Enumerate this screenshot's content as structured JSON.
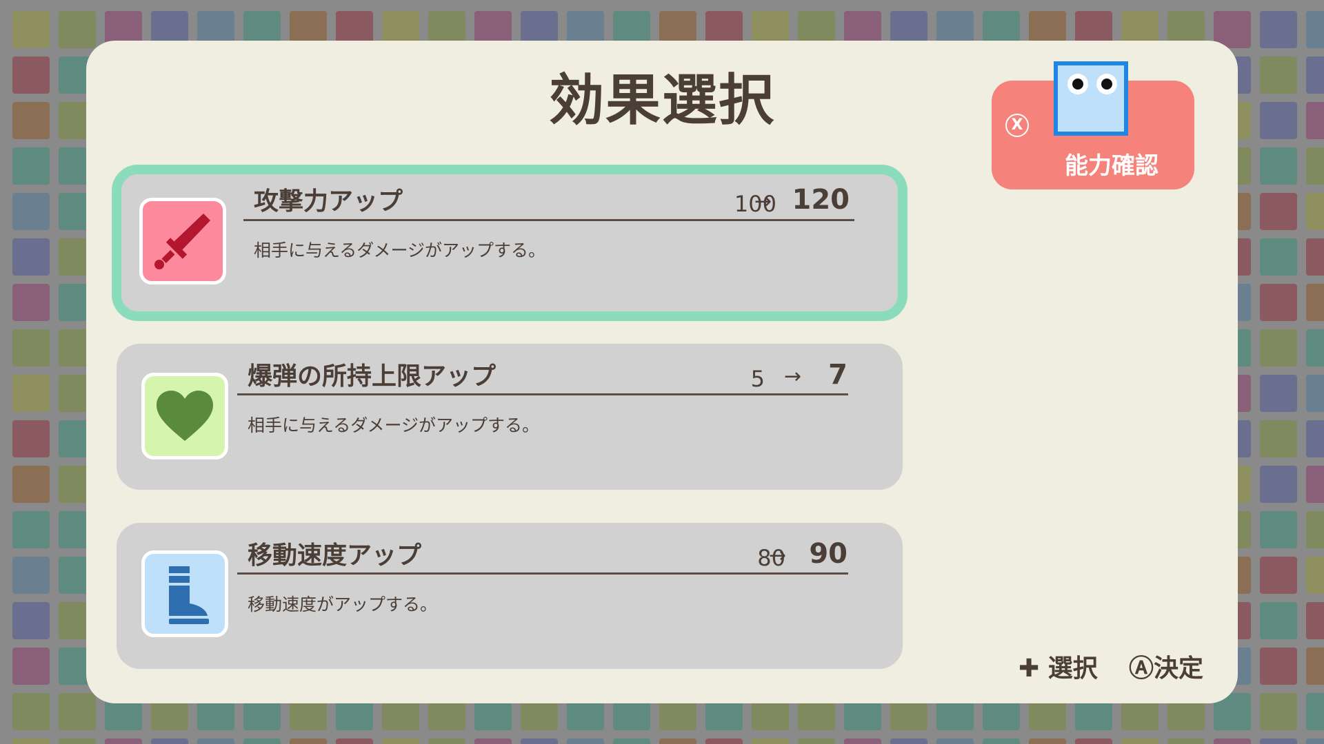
{
  "title": "効果選択",
  "ability_button": {
    "key": "X",
    "label": "能力確認"
  },
  "options": [
    {
      "name": "攻撃力アップ",
      "stat_old": "100",
      "arrow": "→",
      "stat_new": "120",
      "description": "相手に与えるダメージがアップする。",
      "icon": "sword-icon",
      "icon_bg": "#fd8a9c",
      "icon_color": "#b3162f",
      "selected": true
    },
    {
      "name": "爆弾の所持上限アップ",
      "stat_old": "5",
      "arrow": "→",
      "stat_new": "7",
      "description": "相手に与えるダメージがアップする。",
      "icon": "heart-icon",
      "icon_bg": "#d5f4ae",
      "icon_color": "#5a8a3b",
      "selected": false
    },
    {
      "name": "移動速度アップ",
      "stat_old": "80",
      "arrow": "→",
      "stat_new": "90",
      "description": "移動速度がアップする。",
      "icon": "boot-icon",
      "icon_bg": "#bfe0fb",
      "icon_color": "#2e6eae",
      "selected": false
    }
  ],
  "hints": {
    "select": "✚ 選択",
    "confirm": "Ⓐ決定"
  },
  "colors": {
    "panel_bg": "#f0ede1",
    "card_bg": "#d1d1d1",
    "selection_border": "#8bdcbd",
    "ability_button_bg": "#f6837b",
    "mascot_fill": "#bee0fb",
    "mascot_border": "#1f86e3",
    "text": "#4b3e36"
  }
}
